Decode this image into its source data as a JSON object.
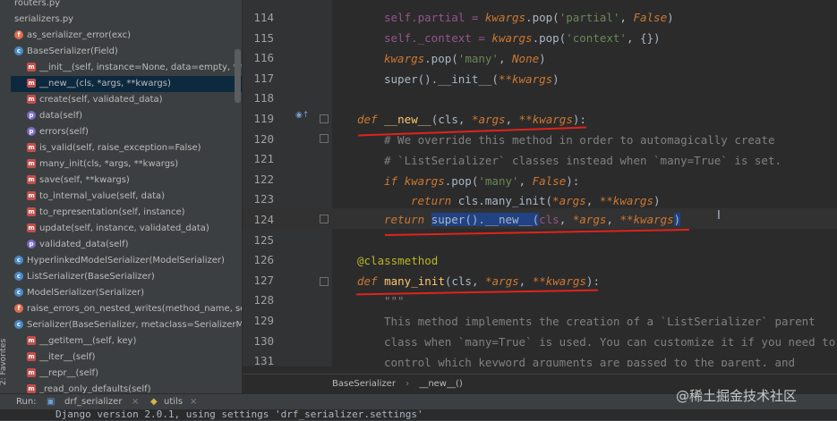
{
  "side_tab": {
    "label": "2: Favorites"
  },
  "structure": {
    "items": [
      {
        "text": "routers.py",
        "icon": "file",
        "indent": 0
      },
      {
        "text": "serializers.py",
        "icon": "file",
        "indent": 0
      },
      {
        "text": "as_serializer_error(exc)",
        "icon": "f",
        "indent": 0
      },
      {
        "text": "BaseSerializer(Field)",
        "icon": "c",
        "indent": 0
      },
      {
        "text": "__init__(self, instance=None, data=empty, **kwargs)",
        "icon": "m",
        "indent": 1
      },
      {
        "text": "__new__(cls, *args, **kwargs)",
        "icon": "m",
        "indent": 1,
        "selected": true
      },
      {
        "text": "create(self, validated_data)",
        "icon": "m",
        "indent": 1
      },
      {
        "text": "data(self)",
        "icon": "p",
        "indent": 1
      },
      {
        "text": "errors(self)",
        "icon": "p",
        "indent": 1
      },
      {
        "text": "is_valid(self, raise_exception=False)",
        "icon": "m",
        "indent": 1
      },
      {
        "text": "many_init(cls, *args, **kwargs)",
        "icon": "m",
        "indent": 1
      },
      {
        "text": "save(self, **kwargs)",
        "icon": "m",
        "indent": 1
      },
      {
        "text": "to_internal_value(self, data)",
        "icon": "m",
        "indent": 1
      },
      {
        "text": "to_representation(self, instance)",
        "icon": "m",
        "indent": 1
      },
      {
        "text": "update(self, instance, validated_data)",
        "icon": "m",
        "indent": 1
      },
      {
        "text": "validated_data(self)",
        "icon": "p",
        "indent": 1
      },
      {
        "text": "HyperlinkedModelSerializer(ModelSerializer)",
        "icon": "c",
        "indent": 0
      },
      {
        "text": "ListSerializer(BaseSerializer)",
        "icon": "c",
        "indent": 0
      },
      {
        "text": "ModelSerializer(Serializer)",
        "icon": "c",
        "indent": 0
      },
      {
        "text": "raise_errors_on_nested_writes(method_name, serializer, validated_data)",
        "icon": "f",
        "indent": 0
      },
      {
        "text": "Serializer(BaseSerializer, metaclass=SerializerMetaclass)",
        "icon": "c",
        "indent": 0
      },
      {
        "text": "__getitem__(self, key)",
        "icon": "m",
        "indent": 1
      },
      {
        "text": "__iter__(self)",
        "icon": "m",
        "indent": 1
      },
      {
        "text": "__repr__(self)",
        "icon": "m",
        "indent": 1
      },
      {
        "text": "_read_only_defaults(self)",
        "icon": "m",
        "indent": 1
      }
    ]
  },
  "editor": {
    "line_numbers": [
      "114",
      "115",
      "116",
      "117",
      "118",
      "119",
      "120",
      "121",
      "122",
      "123",
      "124",
      "125",
      "126",
      "127",
      "128",
      "129",
      "130",
      "131"
    ],
    "code": {
      "l114_a": "self.partial = ",
      "l114_b": "kwargs",
      "l114_c": ".pop(",
      "l114_d": "'partial'",
      "l114_e": ", ",
      "l114_f": "False",
      "l114_g": ")",
      "l115_a": "self._context = ",
      "l115_b": "kwargs",
      "l115_c": ".pop(",
      "l115_d": "'context'",
      "l115_e": ", {})",
      "l116_a": "kwargs",
      "l116_b": ".pop(",
      "l116_c": "'many'",
      "l116_d": ", ",
      "l116_e": "None",
      "l116_f": ")",
      "l117_a": "super().__init__(",
      "l117_b": "**kwargs",
      "l117_c": ")",
      "l119_a": "def ",
      "l119_b": "__new__",
      "l119_c": "(cls, ",
      "l119_d": "*args",
      "l119_e": ", ",
      "l119_f": "**kwargs",
      "l119_g": "):",
      "l120": "# We override this method in order to automagically create",
      "l121": "# `ListSerializer` classes instead when `many=True` is set.",
      "l122_a": "if ",
      "l122_b": "kwargs",
      "l122_c": ".pop(",
      "l122_d": "'many'",
      "l122_e": ", ",
      "l122_f": "False",
      "l122_g": "):",
      "l123_a": "return ",
      "l123_b": "cls.many_init(",
      "l123_c": "*args",
      "l123_d": ", ",
      "l123_e": "**kwargs",
      "l123_f": ")",
      "l124_a": "return ",
      "l124_b": "super().__new__(",
      "l124_c": "cls",
      "l124_d": ", ",
      "l124_e": "*args",
      "l124_f": ", ",
      "l124_g": "**kwargs",
      "l124_h": ")",
      "l126": "@classmethod",
      "l127_a": "def ",
      "l127_b": "many_init",
      "l127_c": "(cls, ",
      "l127_d": "*args",
      "l127_e": ", ",
      "l127_f": "**kwargs",
      "l127_g": "):",
      "l128": "\"\"\"",
      "l129": "This method implements the creation of a `ListSerializer` parent",
      "l130": "class when `many=True` is used. You can customize it if you need to",
      "l131": "control which keyword arguments are passed to the parent, and"
    }
  },
  "breadcrumb": {
    "class_name": "BaseSerializer",
    "sep": "›",
    "method_name": "__new__()"
  },
  "run_bar": {
    "run_label": "Run:",
    "tab1": "drf_serializer",
    "tab1_close": "×",
    "tab2": "utils",
    "tab2_close": "×"
  },
  "console": {
    "line": "Django version 2.0.1, using settings 'drf_serializer.settings'"
  },
  "watermark": {
    "text": "@稀土掘金技术社区"
  },
  "colors": {
    "background": "#2b2b2b",
    "keyword": "#cc7832",
    "string": "#6a8759",
    "comment": "#808080",
    "annotation": "#e0231a"
  }
}
